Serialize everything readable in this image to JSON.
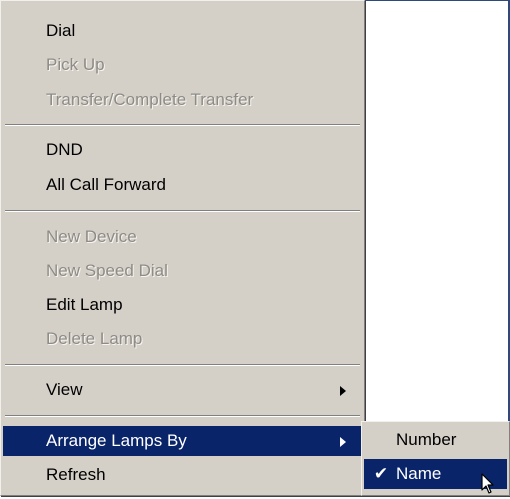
{
  "menu": {
    "items": [
      {
        "label": "Dial",
        "enabled": true
      },
      {
        "label": "Pick Up",
        "enabled": false
      },
      {
        "label": "Transfer/Complete Transfer",
        "enabled": false
      },
      {
        "label": "DND",
        "enabled": true
      },
      {
        "label": "All Call Forward",
        "enabled": true
      },
      {
        "label": "New Device",
        "enabled": false
      },
      {
        "label": "New Speed Dial",
        "enabled": false
      },
      {
        "label": "Edit Lamp",
        "enabled": true
      },
      {
        "label": "Delete Lamp",
        "enabled": false
      },
      {
        "label": "View",
        "enabled": true,
        "has_submenu": true
      },
      {
        "label": "Arrange Lamps By",
        "enabled": true,
        "has_submenu": true,
        "highlighted": true
      },
      {
        "label": "Refresh",
        "enabled": true
      }
    ]
  },
  "submenu": {
    "items": [
      {
        "label": "Number",
        "checked": false
      },
      {
        "label": "Name",
        "checked": true,
        "highlighted": true
      }
    ],
    "check_glyph": "✔"
  },
  "colors": {
    "menu_bg": "#d4d0c8",
    "highlight": "#0a246a",
    "disabled_text": "#8e8b86"
  }
}
